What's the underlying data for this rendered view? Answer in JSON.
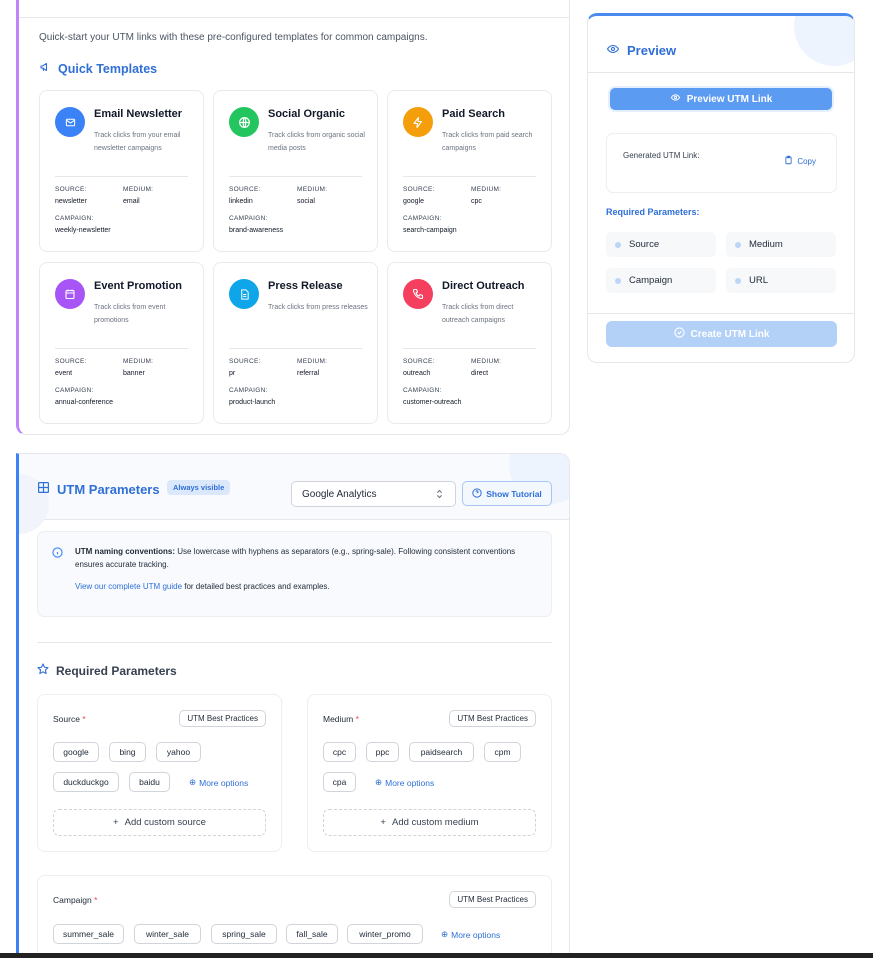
{
  "templates_section": {
    "description": "Quick-start your UTM links with these pre-configured templates for common campaigns.",
    "title": "Quick Templates",
    "source_label": "SOURCE:",
    "medium_label": "MEDIUM:",
    "campaign_label": "CAMPAIGN:",
    "items": [
      {
        "title": "Email Newsletter",
        "desc": "Track clicks from your email newsletter campaigns",
        "source": "newsletter",
        "medium": "email",
        "campaign": "weekly-newsletter",
        "color": "#3b82f6",
        "icon": "mail-icon"
      },
      {
        "title": "Social Organic",
        "desc": "Track clicks from organic social media posts",
        "source": "linkedin",
        "medium": "social",
        "campaign": "brand-awareness",
        "color": "#22c55e",
        "icon": "globe-icon"
      },
      {
        "title": "Paid Search",
        "desc": "Track clicks from paid search campaigns",
        "source": "google",
        "medium": "cpc",
        "campaign": "search-campaign",
        "color": "#f59e0b",
        "icon": "bolt-icon"
      },
      {
        "title": "Event Promotion",
        "desc": "Track clicks from event promotions",
        "source": "event",
        "medium": "banner",
        "campaign": "annual-conference",
        "color": "#a855f7",
        "icon": "calendar-icon"
      },
      {
        "title": "Press Release",
        "desc": "Track clicks from press releases",
        "source": "pr",
        "medium": "referral",
        "campaign": "product-launch",
        "color": "#0ea5e9",
        "icon": "document-icon"
      },
      {
        "title": "Direct Outreach",
        "desc": "Track clicks from direct outreach campaigns",
        "source": "outreach",
        "medium": "direct",
        "campaign": "customer-outreach",
        "color": "#f43f5e",
        "icon": "phone-icon"
      }
    ]
  },
  "preview": {
    "title": "Preview",
    "preview_button": "Preview UTM Link",
    "generated_label": "Generated UTM Link:",
    "copy_label": "Copy",
    "required_title": "Required Parameters:",
    "required": [
      "Source",
      "Medium",
      "Campaign",
      "URL"
    ],
    "create_button": "Create UTM Link"
  },
  "utm": {
    "title": "UTM Parameters",
    "badge": "Always visible",
    "platform": "Google Analytics",
    "tutorial_button": "Show Tutorial",
    "info_bold": "UTM naming conventions:",
    "info_text": " Use lowercase with hyphens as separators (e.g., spring-sale). Following consistent conventions ensures accurate tracking.",
    "guide_link": "View our complete UTM guide",
    "guide_rest": " for detailed best practices and examples.",
    "required_title": "Required Parameters",
    "best_practices": "UTM Best Practices",
    "more_options": "More options",
    "source": {
      "label": "Source",
      "chips": [
        "google",
        "bing",
        "yahoo",
        "duckduckgo",
        "baidu"
      ],
      "add": "Add custom source"
    },
    "medium": {
      "label": "Medium",
      "chips": [
        "cpc",
        "ppc",
        "paidsearch",
        "cpm",
        "cpa"
      ],
      "add": "Add custom medium"
    },
    "campaign": {
      "label": "Campaign",
      "chips": [
        "summer_sale",
        "winter_sale",
        "spring_sale",
        "fall_sale",
        "winter_promo"
      ]
    }
  }
}
